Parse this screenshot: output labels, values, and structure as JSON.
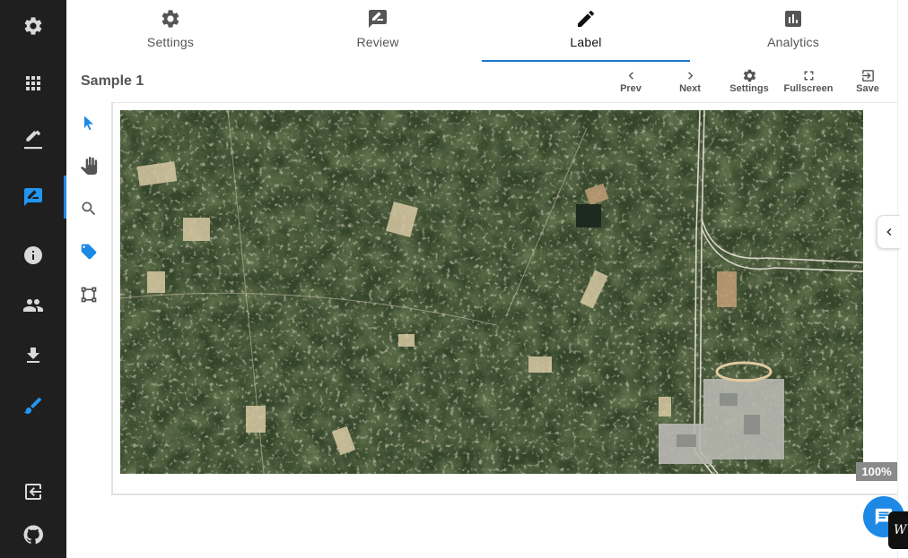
{
  "sidebar": {
    "items": [
      {
        "name": "settings",
        "icon": "gear-icon"
      },
      {
        "name": "apps",
        "icon": "apps-grid-icon"
      },
      {
        "name": "annotate",
        "icon": "pencil-underline-icon"
      },
      {
        "name": "label",
        "icon": "rate-review-icon",
        "active": true
      },
      {
        "name": "info",
        "icon": "info-icon"
      },
      {
        "name": "team",
        "icon": "people-icon"
      },
      {
        "name": "download",
        "icon": "download-icon"
      },
      {
        "name": "brush",
        "icon": "brush-icon"
      },
      {
        "name": "logout",
        "icon": "exit-icon"
      },
      {
        "name": "github",
        "icon": "github-icon"
      }
    ]
  },
  "tabs": [
    {
      "label": "Settings",
      "icon": "gear-icon"
    },
    {
      "label": "Review",
      "icon": "rate-review-icon"
    },
    {
      "label": "Label",
      "icon": "pencil-icon",
      "active": true
    },
    {
      "label": "Analytics",
      "icon": "bar-chart-icon"
    }
  ],
  "toolbar": {
    "title": "Sample 1",
    "prev_label": "Prev",
    "next_label": "Next",
    "settings_label": "Settings",
    "fullscreen_label": "Fullscreen",
    "save_label": "Save"
  },
  "tools": [
    {
      "name": "select",
      "icon": "cursor-arrow-icon"
    },
    {
      "name": "pan",
      "icon": "hand-icon"
    },
    {
      "name": "zoom",
      "icon": "search-icon"
    },
    {
      "name": "tag",
      "icon": "tag-icon"
    },
    {
      "name": "bounding-box",
      "icon": "bounding-box-icon"
    }
  ],
  "viewer": {
    "zoom_level": "100%",
    "image": "aerial satellite imagery"
  },
  "chat": {
    "tag_text": "W"
  },
  "colors": {
    "accent": "#1e88e5",
    "sidebar_bg": "#1f1f1f",
    "active_tab_underline": "#1976d2"
  }
}
